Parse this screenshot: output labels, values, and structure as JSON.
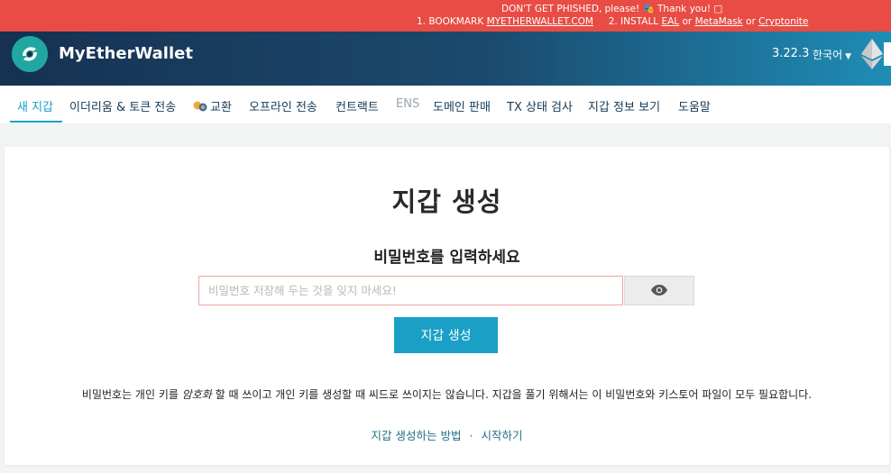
{
  "banner": {
    "line1": "DON'T GET PHISHED, please! 🎭 Thank you! □",
    "step1_prefix": "1. BOOKMARK ",
    "step1_link": "MYETHERWALLET.COM",
    "step2_prefix": "2. INSTALL ",
    "eal": "EAL",
    "or1": " or ",
    "metamask": "MetaMask",
    "or2": " or ",
    "cryptonite": "Cryptonite",
    "color": "#e84c44"
  },
  "header": {
    "brand": "MyEtherWallet",
    "version": "3.22.3",
    "language": "한국어",
    "logo_icon": "mew-logo-icon",
    "network_icon": "ethereum-icon"
  },
  "nav": {
    "items": [
      {
        "label": "새 지갑",
        "state": "active"
      },
      {
        "label": "이더리움 & 토큰 전송",
        "state": "normal"
      },
      {
        "label": "교환",
        "state": "normal",
        "icon": "swap-icon"
      },
      {
        "label": "오프라인 전송",
        "state": "normal"
      },
      {
        "label": "컨트랙트",
        "state": "normal"
      },
      {
        "label": "ENS",
        "state": "disabled"
      },
      {
        "label": "도메인 판매",
        "state": "normal"
      },
      {
        "label": "TX 상태 검사",
        "state": "normal"
      },
      {
        "label": "지갑 정보 보기",
        "state": "normal"
      },
      {
        "label": "도움말",
        "state": "normal"
      }
    ],
    "accent_color": "#1aa0c6"
  },
  "main": {
    "title": "지갑 생성",
    "subtitle": "비밀번호를 입력하세요",
    "password_placeholder": "비밀번호 저장해 두는 것을 잊지 마세요!",
    "password_value": "",
    "eye_icon": "eye-icon",
    "create_button": "지갑 생성",
    "desc_part1": "비밀번호는 개인 키를 ",
    "desc_em": "암호화",
    "desc_part2": " 할 때 쓰이고 개인 키를 생성할 때 씨드로 쓰이지는 않습니다. 지갑을 풀기 위해서는 이 비밀번호와 키스토어 파일이 모두 필요합니다.",
    "link_how": "지갑 생성하는 방법",
    "link_separator": "·",
    "link_start": "시작하기"
  }
}
